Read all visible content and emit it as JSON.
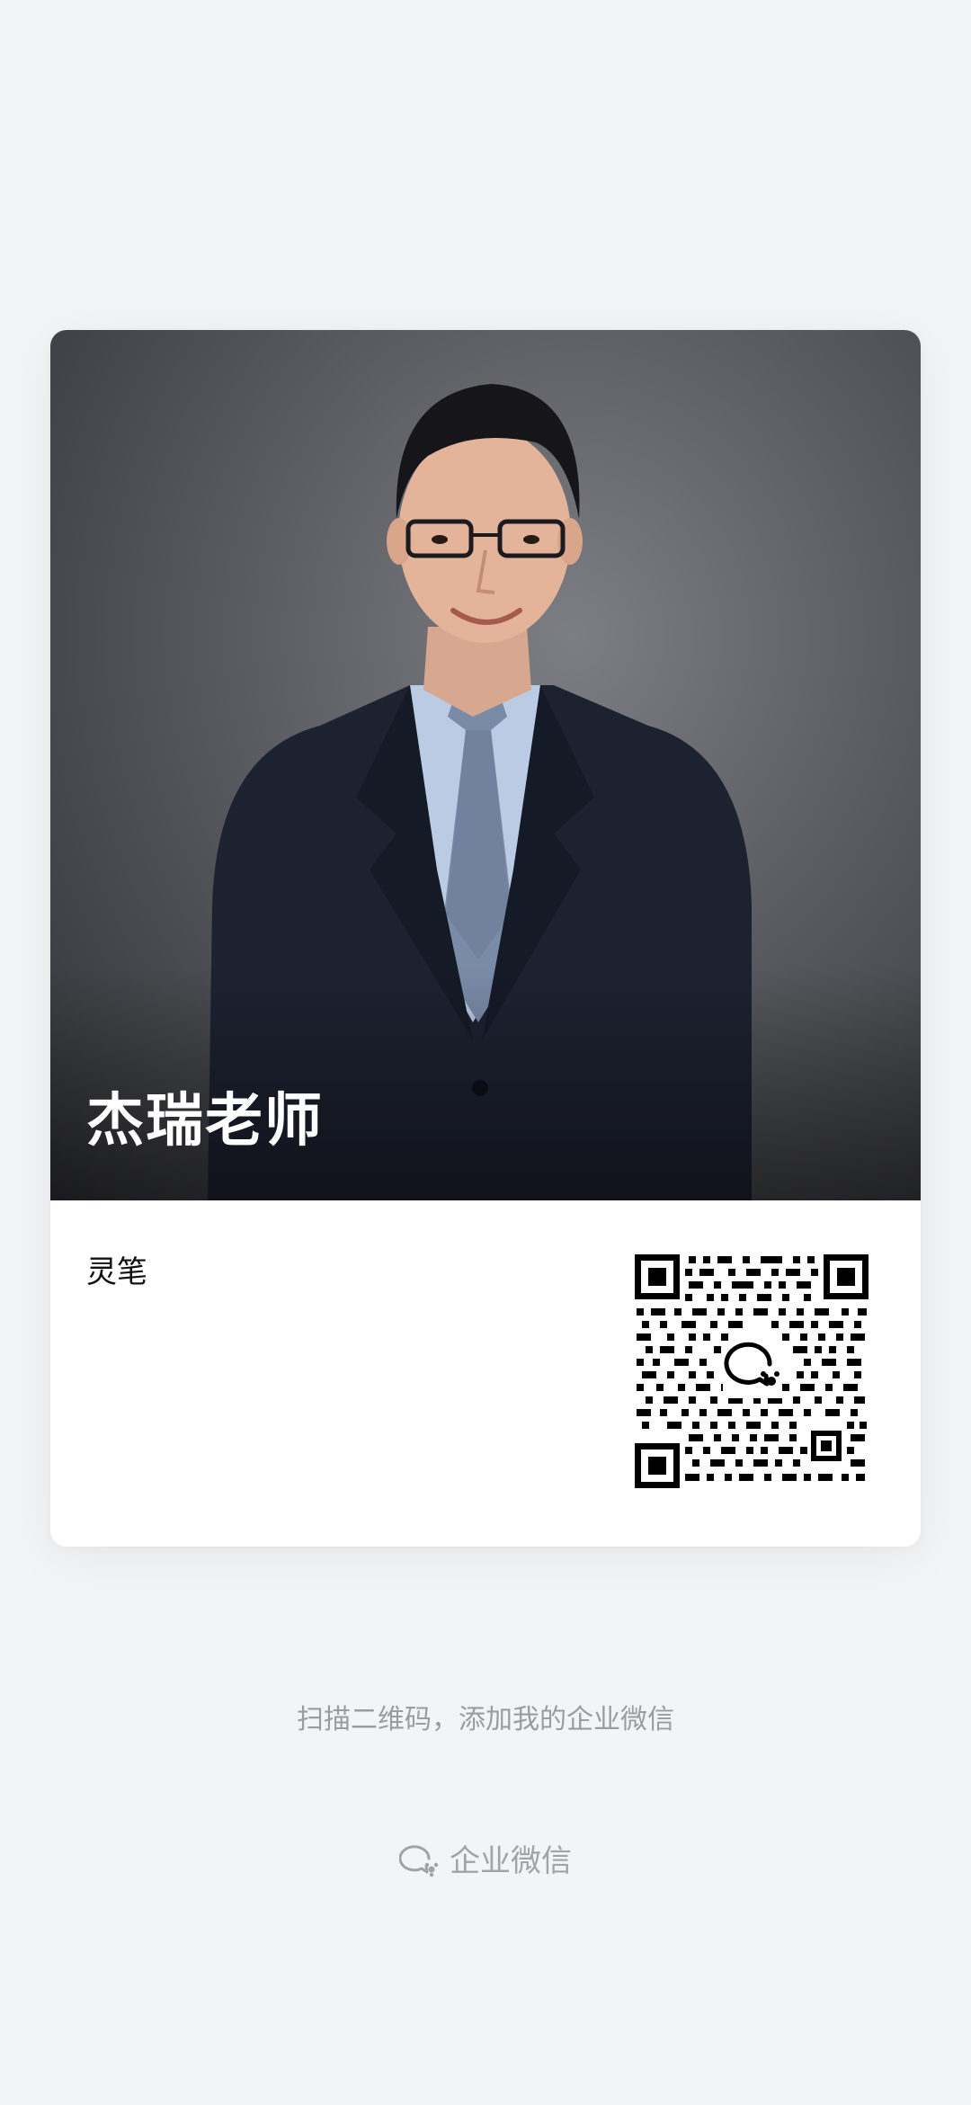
{
  "profile": {
    "name": "杰瑞老师",
    "company": "灵笔",
    "photo_icon": "person-portrait"
  },
  "qr": {
    "icon": "wecom-qr-code"
  },
  "footer": {
    "hint": "扫描二维码，添加我的企业微信",
    "brand": "企业微信",
    "brand_icon": "wecom-logo-icon"
  },
  "colors": {
    "background": "#f3f4f6",
    "card": "#ffffff",
    "hint_text": "#9b9ca1"
  }
}
